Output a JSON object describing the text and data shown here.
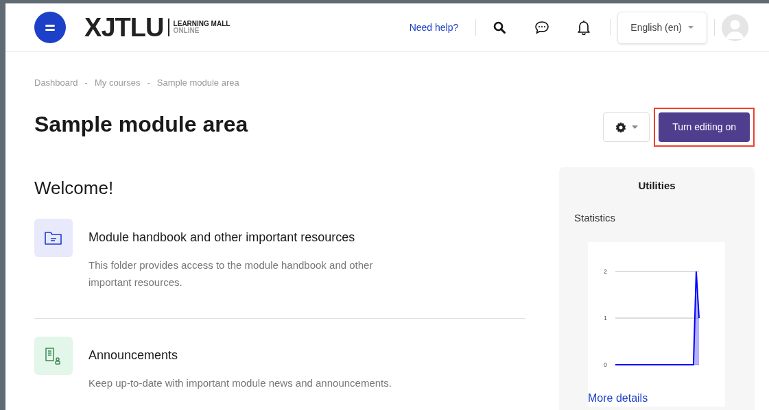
{
  "header": {
    "logo": {
      "brand": "XJTLU",
      "line_1": "LEARNING MALL",
      "line_2": "ONLINE"
    },
    "help_link": "Need help?",
    "language": "English (en)"
  },
  "breadcrumb": {
    "separator": "-",
    "items": [
      "Dashboard",
      "My courses",
      "Sample module area"
    ]
  },
  "page_title": "Sample module area",
  "editing_button": {
    "label": "Turn editing on",
    "highlighted": true
  },
  "section_title": "Welcome!",
  "activities": [
    {
      "kind": "folder",
      "title": "Module handbook and other important resources",
      "description": "This folder provides access to the module handbook and other important resources."
    },
    {
      "kind": "forum",
      "title": "Announcements",
      "description": "Keep up-to-date with important module news and announcements."
    }
  ],
  "utilities": {
    "title": "Utilities",
    "statistics": {
      "title": "Statistics",
      "chart_data": {
        "type": "area",
        "ylim": [
          0,
          2
        ],
        "yticks": [
          0,
          1,
          2
        ],
        "series": [
          {
            "color": "#0000ff",
            "values": [
              0,
              0,
              0,
              0,
              0,
              0,
              0,
              0,
              0,
              0,
              0,
              0,
              0,
              0,
              0,
              0,
              0,
              0,
              0,
              0,
              0,
              0,
              0,
              0,
              0,
              0,
              0,
              0,
              0,
              2,
              1
            ]
          }
        ]
      },
      "link": "More details"
    }
  }
}
